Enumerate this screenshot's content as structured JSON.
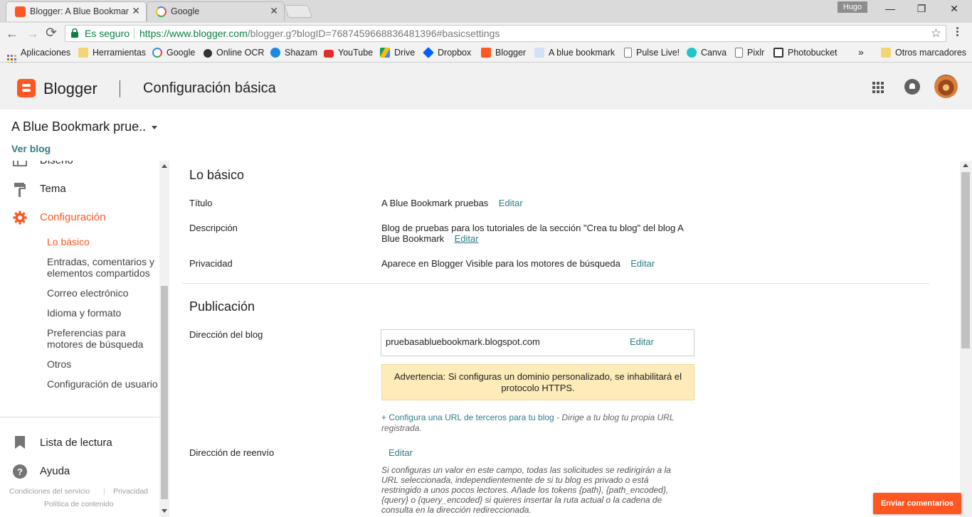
{
  "browser": {
    "tabs": [
      {
        "title": "Blogger: A Blue Bookmar",
        "close": "✕"
      },
      {
        "title": "Google",
        "close": "✕"
      }
    ],
    "profile_name": "Hugo",
    "window_controls": {
      "minimize": "—",
      "maximize": "❐",
      "close": "✕"
    },
    "nav": {
      "back": "←",
      "forward": "→",
      "reload": "⟳"
    },
    "omnibox": {
      "secure_label": "Es seguro",
      "url_host": "https://www.blogger.com",
      "url_path": "/blogger.g?blogID=7687459668836481396#basicsettings",
      "star": "☆"
    },
    "bookmarks": [
      {
        "label": "Aplicaciones",
        "icon": "apps-icon"
      },
      {
        "label": "Herramientas",
        "icon": "folder-icon"
      },
      {
        "label": "Google",
        "icon": "google-icon"
      },
      {
        "label": "Online OCR",
        "icon": "ocr-icon"
      },
      {
        "label": "Shazam",
        "icon": "shazam-icon"
      },
      {
        "label": "YouTube",
        "icon": "youtube-icon"
      },
      {
        "label": "Drive",
        "icon": "drive-icon"
      },
      {
        "label": "Dropbox",
        "icon": "dropbox-icon"
      },
      {
        "label": "Blogger",
        "icon": "blogger-icon"
      },
      {
        "label": "A blue bookmark",
        "icon": "bookmark-site-icon"
      },
      {
        "label": "Pulse Live!",
        "icon": "page-icon"
      },
      {
        "label": "Canva",
        "icon": "canva-icon"
      },
      {
        "label": "Pixlr",
        "icon": "page-icon"
      },
      {
        "label": "Photobucket",
        "icon": "photobucket-icon"
      }
    ],
    "more_bookmarks": "»",
    "other_bookmarks": "Otros marcadores"
  },
  "header": {
    "brand": "Blogger",
    "page_title": "Configuración básica"
  },
  "blog_selector": {
    "name": "A Blue Bookmark prue..",
    "view_blog": "Ver blog"
  },
  "sidebar": {
    "partial_item": "Diseño",
    "theme": "Tema",
    "settings": "Configuración",
    "sub_items": [
      "Lo básico",
      "Entradas, comentarios y elementos compartidos",
      "Correo electrónico",
      "Idioma y formato",
      "Preferencias para motores de búsqueda",
      "Otros",
      "Configuración de usuario"
    ],
    "reading_list": "Lista de lectura",
    "help": "Ayuda",
    "footer": {
      "terms": "Condiciones del servicio",
      "privacy": "Privacidad",
      "content_policy": "Política de contenido"
    }
  },
  "main": {
    "basics": {
      "title": "Lo básico",
      "title_label": "Título",
      "title_value": "A Blue Bookmark pruebas",
      "description_label": "Descripción",
      "description_value": "Blog de pruebas para los tutoriales de la sección \"Crea tu blog\" del blog A Blue Bookmark",
      "privacy_label": "Privacidad",
      "privacy_value": "Aparece en Blogger Visible para los motores de búsqueda",
      "edit": "Editar"
    },
    "publishing": {
      "title": "Publicación",
      "address_label": "Dirección del blog",
      "address_value": "pruebasabluebookmark.blogspot.com",
      "edit": "Editar",
      "warning": "Advertencia: Si configuras un dominio personalizado, se inhabilitará el protocolo HTTPS.",
      "third_party_link": "+ Configura una URL de terceros para tu blog",
      "third_party_desc": " - Dirige a tu blog tu propia URL registrada.",
      "redirect_label": "Dirección de reenvío",
      "redirect_edit": "Editar",
      "redirect_help": "Si configuras un valor en este campo, todas las solicitudes se redirigirán a la URL seleccionada, independientemente de si tu blog es privado o está restringido a unos pocos lectores. Añade los tokens {path}, {path_encoded}, {query} o {query_encoded} si quieres insertar la ruta actual o la cadena de consulta en la dirección redireccionada."
    }
  },
  "feedback_button": "Enviar comentarios",
  "colors": {
    "accent": "#ff5722",
    "link": "#2e7d86",
    "warning_bg": "#fdecb9"
  }
}
